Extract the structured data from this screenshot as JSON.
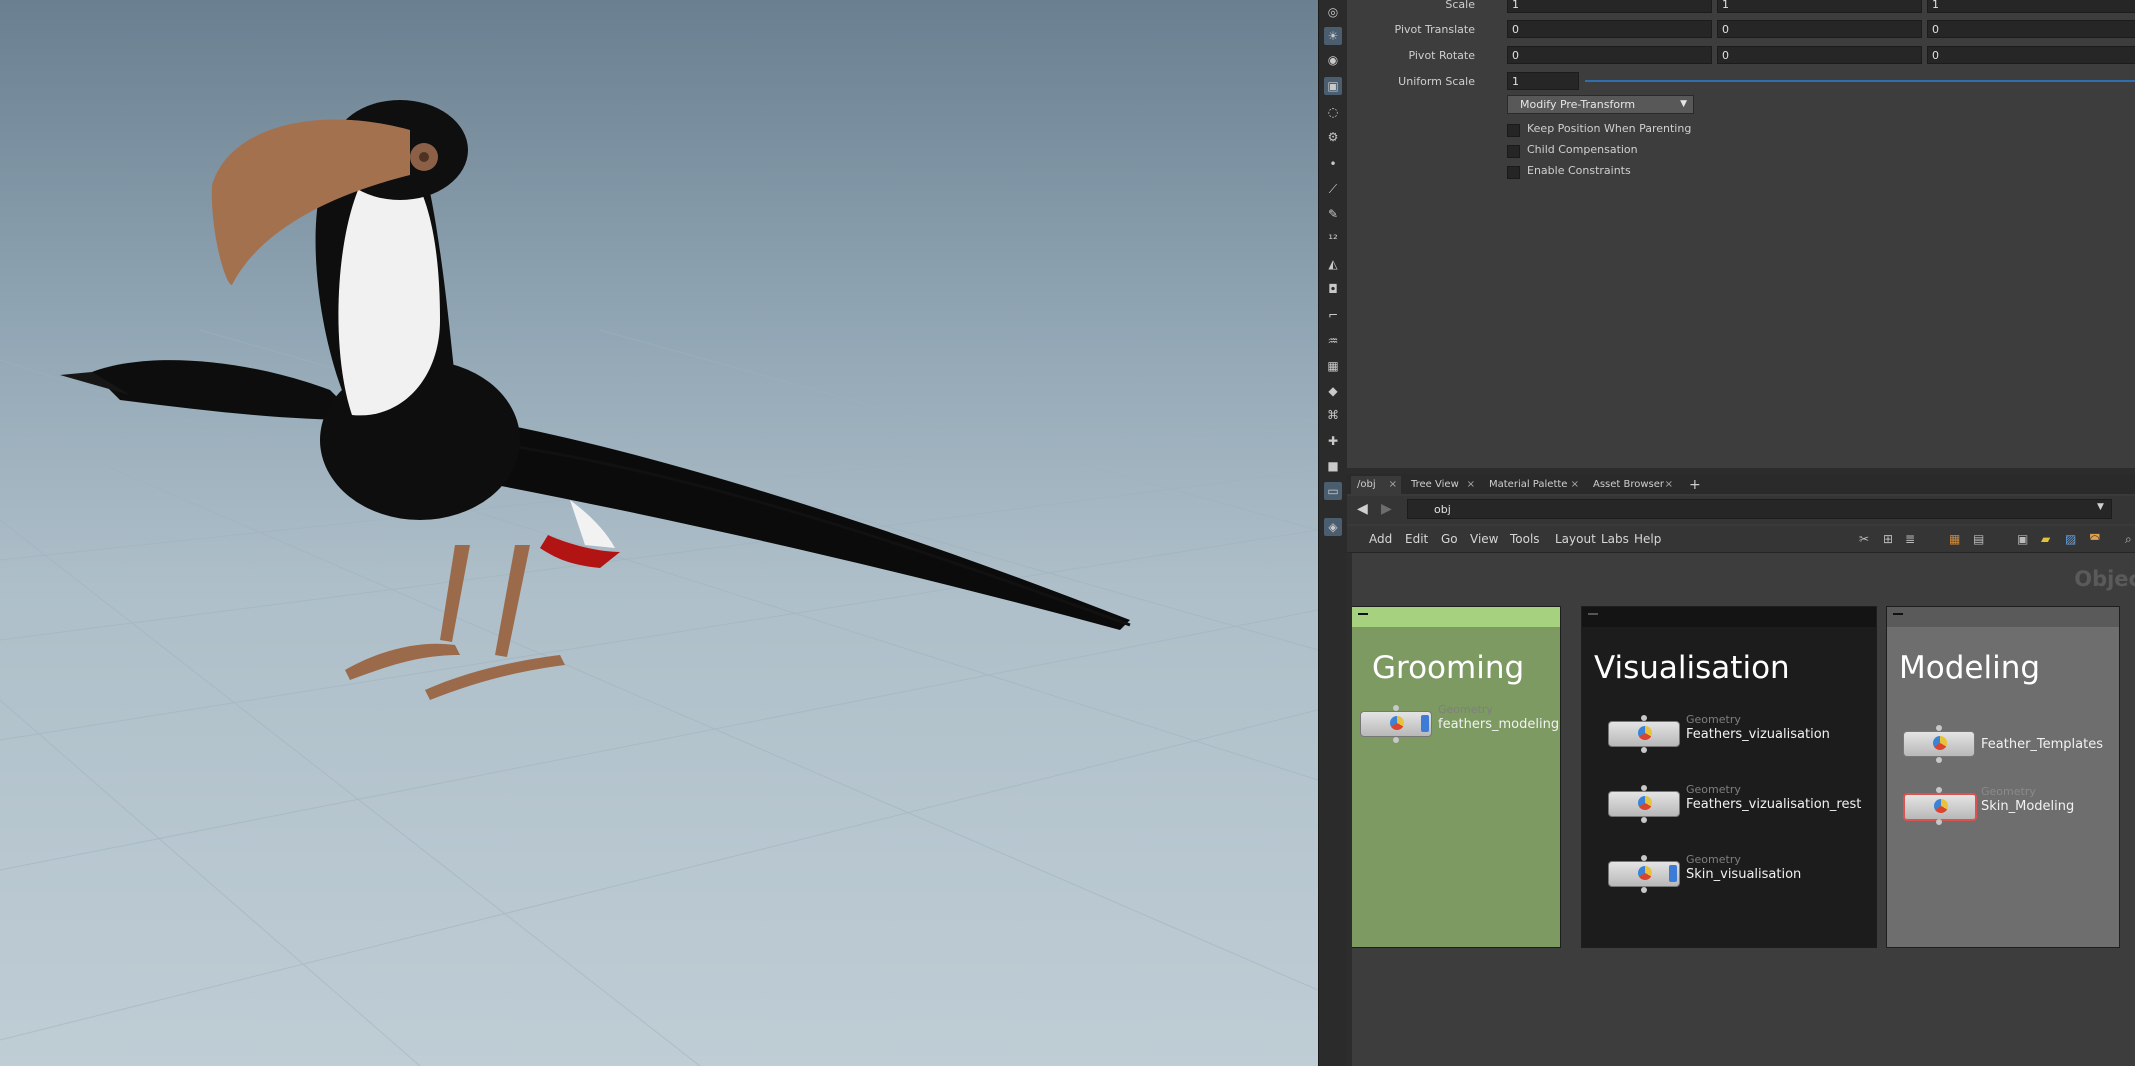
{
  "parameters": {
    "rows": [
      {
        "label": "Scale",
        "values": [
          "1",
          "1",
          "1"
        ]
      },
      {
        "label": "Pivot Translate",
        "values": [
          "0",
          "0",
          "0"
        ]
      },
      {
        "label": "Pivot Rotate",
        "values": [
          "0",
          "0",
          "0"
        ]
      },
      {
        "label": "Uniform Scale",
        "values": [
          "1"
        ]
      }
    ],
    "uniform_scale_slider": 0.0,
    "pre_transform_menu": "Modify Pre-Transform",
    "checkboxes": [
      {
        "label": "Keep Position When Parenting",
        "checked": false
      },
      {
        "label": "Child Compensation",
        "checked": false
      },
      {
        "label": "Enable Constraints",
        "checked": false
      }
    ]
  },
  "tabs": [
    {
      "label": "/obj",
      "active": true
    },
    {
      "label": "Tree View",
      "active": false
    },
    {
      "label": "Material Palette",
      "active": false
    },
    {
      "label": "Asset Browser",
      "active": false
    }
  ],
  "add_tab_icon": "plus-icon",
  "path": {
    "value": "obj"
  },
  "menu": [
    "Add",
    "Edit",
    "Go",
    "View",
    "Tools",
    "Layout",
    "Labs",
    "Help"
  ],
  "network": {
    "context_label": "Objec",
    "boxes": [
      {
        "title": "Grooming",
        "header_color": "#a6d17f",
        "body_color": "#7d9a62",
        "nodes": [
          {
            "type": "Geometry",
            "name": "feathers_modeling",
            "display_flag": true,
            "selected": false
          }
        ]
      },
      {
        "title": "Visualisation",
        "header_color": "#141414",
        "body_color": "#1c1c1c",
        "nodes": [
          {
            "type": "Geometry",
            "name": "Feathers_vizualisation",
            "display_flag": false,
            "selected": false
          },
          {
            "type": "Geometry",
            "name": "Feathers_vizualisation_rest",
            "display_flag": false,
            "selected": false
          },
          {
            "type": "Geometry",
            "name": "Skin_visualisation",
            "display_flag": true,
            "selected": false
          }
        ]
      },
      {
        "title": "Modeling",
        "header_color": "#5a5a5a",
        "body_color": "#6e6e6e",
        "nodes": [
          {
            "type": "",
            "name": "Feather_Templates",
            "display_flag": false,
            "selected": false
          },
          {
            "type": "Geometry",
            "name": "Skin_Modeling",
            "display_flag": false,
            "selected": true
          }
        ]
      }
    ]
  },
  "toolbar_icons": [
    "sphere-icon",
    "light-icon",
    "camera-icon",
    "view-icon",
    "ring-icon",
    "gear-icon",
    "dot-icon",
    "brush-icon",
    "pen-icon",
    "number-icon",
    "bucket-icon",
    "stamp-icon",
    "corner-icon",
    "hair-icon",
    "grid-icon",
    "diamond-icon",
    "ribbon-icon",
    "needle-icon",
    "square-icon",
    "display-icon",
    "lamp-icon"
  ]
}
